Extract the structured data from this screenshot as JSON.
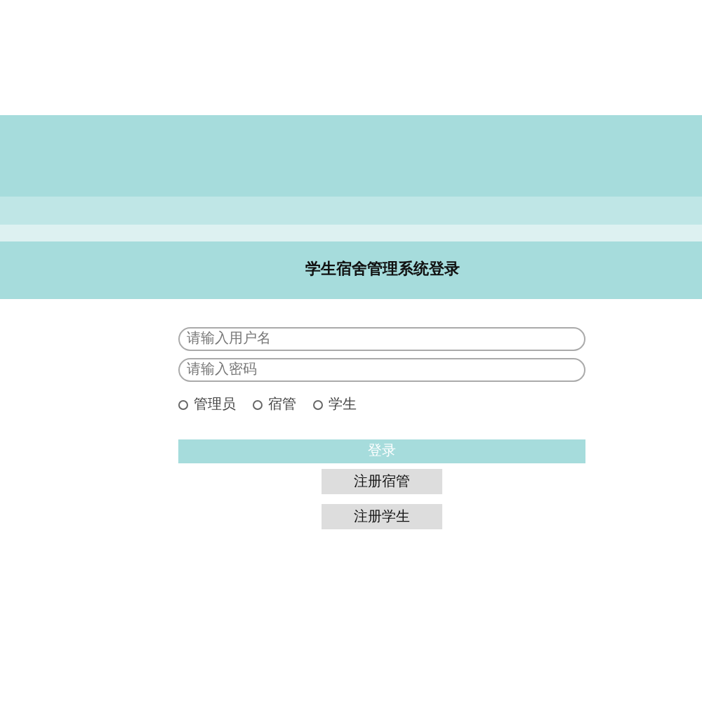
{
  "header": {
    "title": "学生宿舍管理系统登录"
  },
  "fields": [
    {
      "placeholder": "请输入用户名"
    },
    {
      "placeholder": "请输入密码"
    }
  ],
  "roles": [
    {
      "label": "管理员",
      "selected": false
    },
    {
      "label": "宿管",
      "selected": false
    },
    {
      "label": "学生",
      "selected": false
    }
  ],
  "login_button": "登录",
  "register_buttons": [
    "注册宿管",
    "注册学生"
  ]
}
